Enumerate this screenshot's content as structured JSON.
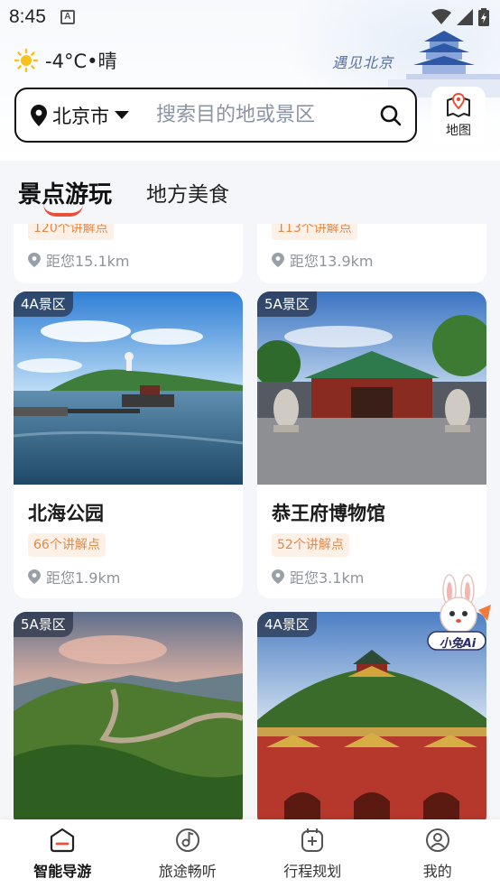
{
  "status_bar": {
    "time": "8:45"
  },
  "header": {
    "weather": "-4°C•晴",
    "slogan": "遇见北京",
    "city": "北京市",
    "search_placeholder": "搜索目的地或景区",
    "map_label": "地图"
  },
  "tabs": [
    {
      "label": "景点游玩",
      "active": true
    },
    {
      "label": "地方美食",
      "active": false
    }
  ],
  "partial_cards": [
    {
      "points": "120个讲解点",
      "distance": "距您15.1km"
    },
    {
      "points": "113个讲解点",
      "distance": "距您13.9km"
    }
  ],
  "cards": [
    {
      "badge": "4A景区",
      "name": "北海公园",
      "points": "66个讲解点",
      "distance": "距您1.9km"
    },
    {
      "badge": "5A景区",
      "name": "恭王府博物馆",
      "points": "52个讲解点",
      "distance": "距您3.1km"
    },
    {
      "badge": "5A景区",
      "name": "",
      "points": "",
      "distance": ""
    },
    {
      "badge": "4A景区",
      "name": "",
      "points": "",
      "distance": ""
    }
  ],
  "ai_assistant": {
    "label": "小兔Ai"
  },
  "bottom_nav": [
    {
      "label": "智能导游",
      "icon": "home-icon",
      "active": true
    },
    {
      "label": "旅途畅听",
      "icon": "music-icon",
      "active": false
    },
    {
      "label": "行程规划",
      "icon": "plan-icon",
      "active": false
    },
    {
      "label": "我的",
      "icon": "profile-icon",
      "active": false
    }
  ],
  "colors": {
    "accent": "#e8503a",
    "pill_bg": "#fdf0e6",
    "pill_text": "#e08a4c"
  }
}
